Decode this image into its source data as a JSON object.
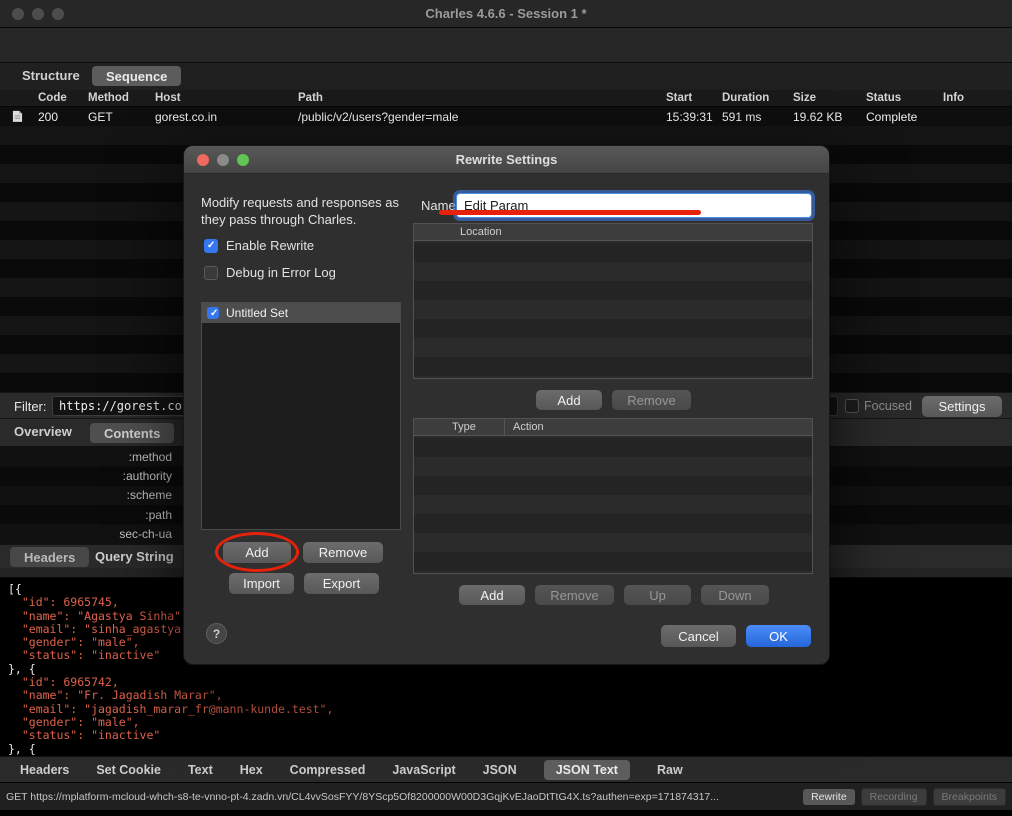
{
  "colors": {
    "accent_blue": "#3577f0",
    "annotation_red": "#e8220a",
    "json_text": "#df634b"
  },
  "window": {
    "title": "Charles 4.6.6 - Session 1 *",
    "traffic_lights": [
      "close",
      "minimize",
      "zoom"
    ]
  },
  "toolbar": {
    "icons": [
      "clear-broom-icon",
      "record-icon",
      "ssl-lock-icon",
      "throttle-turtle-icon",
      "breakpoints-icon",
      "compose-pencil-icon",
      "repeat-icon",
      "validate-check-icon",
      "publish-basket-icon",
      "tools-icon",
      "settings-gear-icon"
    ]
  },
  "view_tabs": {
    "structure": "Structure",
    "sequence": "Sequence"
  },
  "session_table": {
    "headers": [
      "Code",
      "Method",
      "Host",
      "Path",
      "Start",
      "Duration",
      "Size",
      "Status",
      "Info"
    ],
    "row": {
      "code": "200",
      "method": "GET",
      "host": "gorest.co.in",
      "path": "/public/v2/users?gender=male",
      "start": "15:39:31",
      "duration": "591 ms",
      "size": "19.62 KB",
      "status": "Complete",
      "info": ""
    }
  },
  "filter_bar": {
    "label": "Filter:",
    "value": "https://gorest.co.in/p",
    "focused_label": "Focused",
    "settings_label": "Settings"
  },
  "content_tabs": {
    "overview": "Overview",
    "contents": "Contents"
  },
  "request_pane": {
    "header_names": [
      ":method",
      ":authority",
      ":scheme",
      ":path",
      "sec-ch-ua"
    ],
    "tabs": {
      "headers": "Headers",
      "query_string": "Query String"
    }
  },
  "response_pane": {
    "json_lines": [
      "[{",
      "  \"id\": 6965745,",
      "  \"name\": \"Agastya Sinha\"",
      "  \"email\": \"sinha_agastya",
      "  \"gender\": \"male\",",
      "  \"status\": \"inactive\"",
      "}, {",
      "  \"id\": 6965742,",
      "  \"name\": \"Fr. Jagadish Marar\",",
      "  \"email\": \"jagadish_marar_fr@mann-kunde.test\",",
      "  \"gender\": \"male\",",
      "  \"status\": \"inactive\"",
      "}, {"
    ],
    "tabs": [
      "Headers",
      "Set Cookie",
      "Text",
      "Hex",
      "Compressed",
      "JavaScript",
      "JSON",
      "JSON Text",
      "Raw"
    ],
    "selected_tab": "JSON Text"
  },
  "status_bar": {
    "request": "GET https://mplatform-mcloud-whch-s8-te-vnno-pt-4.zadn.vn/CL4vvSosFYY/8YScp5Of8200000W00D3GqjKvEJaoDtTtG4X.ts?authen=exp=171874317...",
    "buttons": [
      "Rewrite",
      "Recording",
      "Breakpoints"
    ]
  },
  "dialog": {
    "title": "Rewrite Settings",
    "description": "Modify requests and responses as they pass through Charles.",
    "enable_rewrite_label": "Enable Rewrite",
    "debug_label": "Debug in Error Log",
    "sets": [
      {
        "label": "Untitled Set",
        "checked": true
      }
    ],
    "set_buttons": {
      "add": "Add",
      "remove": "Remove",
      "import": "Import",
      "export": "Export"
    },
    "name_label": "Name:",
    "name_value": "Edit Param",
    "location_panel": {
      "header": "Location",
      "add": "Add",
      "remove": "Remove"
    },
    "rules_panel": {
      "type_header": "Type",
      "action_header": "Action",
      "add": "Add",
      "remove": "Remove",
      "up": "Up",
      "down": "Down"
    },
    "help_label": "?",
    "cancel_label": "Cancel",
    "ok_label": "OK"
  }
}
